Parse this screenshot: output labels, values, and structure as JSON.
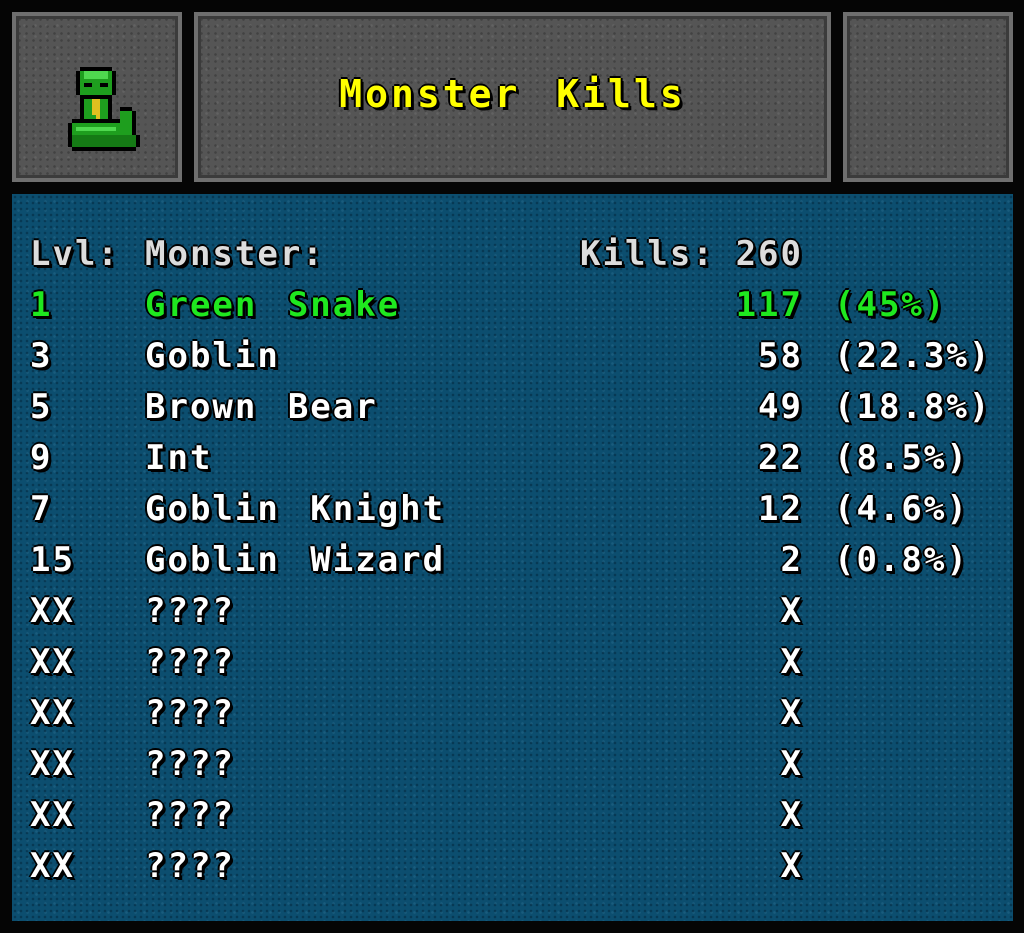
{
  "title": "Monster Kills",
  "icon": "green-snake-icon",
  "colors": {
    "title": "#ffff00",
    "highlight": "#1fe81f",
    "text": "#ffffff",
    "panel": "#0c4e6f",
    "stone": "#555555"
  },
  "header": {
    "lvl": "Lvl:",
    "monster": "Monster:",
    "kills_label": "Kills:",
    "total": "260"
  },
  "rows": [
    {
      "lvl": "1",
      "name": "Green Snake",
      "kills": "117",
      "pct": "(45%)",
      "highlight": true
    },
    {
      "lvl": "3",
      "name": "Goblin",
      "kills": "58",
      "pct": "(22.3%)"
    },
    {
      "lvl": "5",
      "name": "Brown Bear",
      "kills": "49",
      "pct": "(18.8%)"
    },
    {
      "lvl": "9",
      "name": "Int",
      "kills": "22",
      "pct": "(8.5%)"
    },
    {
      "lvl": "7",
      "name": "Goblin Knight",
      "kills": "12",
      "pct": "(4.6%)"
    },
    {
      "lvl": "15",
      "name": "Goblin Wizard",
      "kills": "2",
      "pct": "(0.8%)"
    },
    {
      "lvl": "XX",
      "name": "????",
      "kills": "X",
      "pct": ""
    },
    {
      "lvl": "XX",
      "name": "????",
      "kills": "X",
      "pct": ""
    },
    {
      "lvl": "XX",
      "name": "????",
      "kills": "X",
      "pct": ""
    },
    {
      "lvl": "XX",
      "name": "????",
      "kills": "X",
      "pct": ""
    },
    {
      "lvl": "XX",
      "name": "????",
      "kills": "X",
      "pct": ""
    },
    {
      "lvl": "XX",
      "name": "????",
      "kills": "X",
      "pct": ""
    }
  ]
}
